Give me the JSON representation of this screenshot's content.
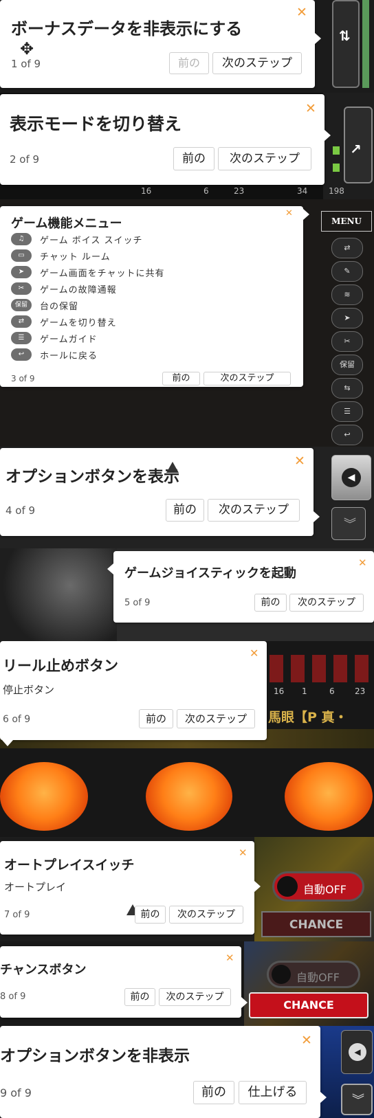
{
  "steps": [
    {
      "title": "ボーナスデータを非表示にする",
      "count": "1 of 9",
      "prev": "前の",
      "next": "次のステップ"
    },
    {
      "title": "表示モードを切り替え",
      "count": "2 of 9",
      "prev": "前の",
      "next": "次のステップ"
    },
    {
      "title": "ゲーム機能メニュー",
      "count": "3 of 9",
      "prev": "前の",
      "next": "次のステップ",
      "menu_items": [
        {
          "icon": "voice",
          "label": "ゲーム ボイス スイッチ"
        },
        {
          "icon": "chat",
          "label": "チャット ルーム"
        },
        {
          "icon": "send",
          "label": "ゲーム画面をチャットに共有"
        },
        {
          "icon": "tools",
          "label": "ゲームの故障通報"
        },
        {
          "icon": "保留",
          "label": "台の保留"
        },
        {
          "icon": "switch",
          "label": "ゲームを切り替え"
        },
        {
          "icon": "guide",
          "label": "ゲームガイド"
        },
        {
          "icon": "back",
          "label": "ホールに戻る"
        }
      ]
    },
    {
      "title": "オプションボタンを表示",
      "count": "4 of 9",
      "prev": "前の",
      "next": "次のステップ"
    },
    {
      "title": "ゲームジョイスティックを起動",
      "count": "5 of 9",
      "prev": "前の",
      "next": "次のステップ"
    },
    {
      "title": "リール止めボタン",
      "subtitle": "停止ボタン",
      "count": "6 of 9",
      "prev": "前の",
      "next": "次のステップ"
    },
    {
      "title": "オートプレイスイッチ",
      "subtitle": "オートプレイ",
      "count": "7 of 9",
      "prev": "前の",
      "next": "次のステップ"
    },
    {
      "title": "チャンスボタン",
      "count": "8 of 9",
      "prev": "前の",
      "next": "次のステップ"
    },
    {
      "title": "オプションボタンを非表示",
      "count": "9 of 9",
      "prev": "前の",
      "next": "仕上げる"
    }
  ],
  "close_symbol": "✕",
  "game": {
    "menu_label": "MENU",
    "hold_label": "保留",
    "numbers_row": [
      "16",
      "6",
      "23",
      "34",
      "198"
    ],
    "numbers_row2": [
      "16",
      "1",
      "6",
      "23"
    ],
    "auto_off_label": "自動OFF",
    "chance_label": "CHANCE",
    "header_text": "馬眼【P 真・"
  },
  "colors": {
    "accent": "#f29d3a",
    "chance_red": "#c4101b"
  }
}
